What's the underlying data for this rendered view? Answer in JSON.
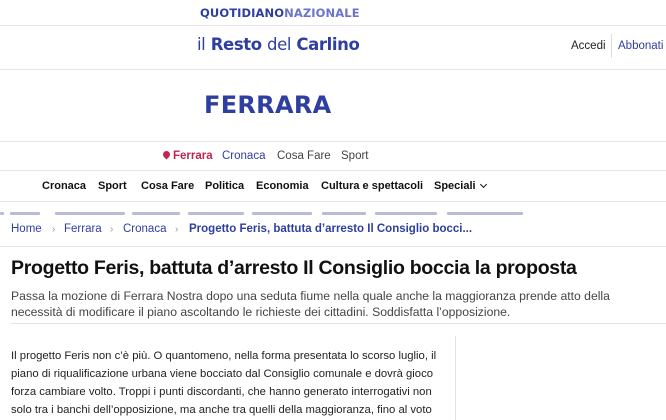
{
  "network": {
    "part1": "QUOTIDIANO",
    "part2": "NAZIONALE"
  },
  "masthead": {
    "brand_il": "il",
    "brand_resto": "Resto",
    "brand_del": "del",
    "brand_carlino": "Carlino",
    "login_label": "Accedi",
    "subscribe_label": "Abbonati"
  },
  "city": {
    "name": "FERRARA"
  },
  "local_nav": {
    "items": [
      "Ferrara",
      "Cronaca",
      "Cosa Fare",
      "Sport"
    ]
  },
  "main_nav": {
    "items": [
      "Cronaca",
      "Sport",
      "Cosa Fare",
      "Politica",
      "Economia",
      "Cultura e spettacoli",
      "Speciali"
    ]
  },
  "breadcrumb": {
    "items": [
      "Home",
      "Ferrara",
      "Cronaca",
      "Progetto Feris, battuta d’arresto Il Consiglio bocci..."
    ],
    "separator": "›"
  },
  "article": {
    "title": "Progetto Feris, battuta d’arresto Il Consiglio boccia la proposta",
    "subtitle": "Passa la mozione di Ferrara Nostra dopo una seduta fiume nella quale anche la maggioranza prende atto della necessità di modificare il piano ascoltando le richieste dei cittadini. Soddisfatta l’opposizione.",
    "body": "Il progetto Feris non c’è più. O quantomeno, nella forma presentata lo scorso luglio, il piano di riqualificazione urbana viene bocciato dal Consiglio comunale e dovrà gioco forza cambiare volto. Troppi i punti discordanti, che hanno generato interrogativi non solo tra i banchi dell’opposizione, ma anche tra quelli della maggioranza, fino al voto di"
  },
  "colors": {
    "brand": "#2f3fa0",
    "accent": "#c0244f"
  }
}
